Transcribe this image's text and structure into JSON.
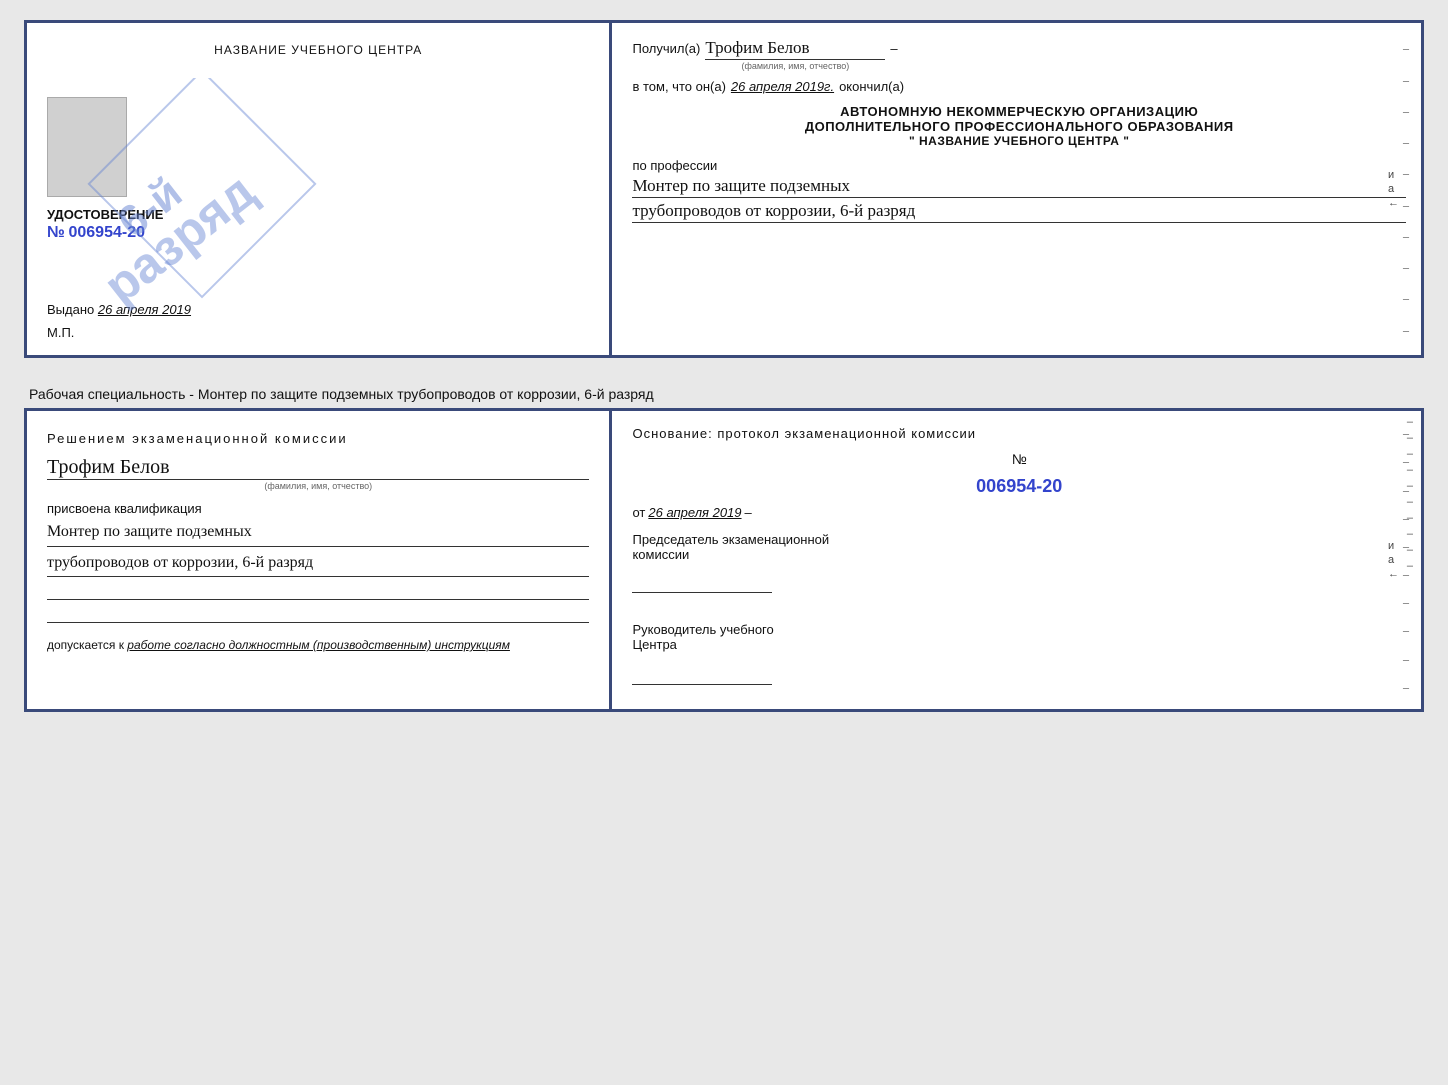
{
  "page": {
    "background": "#e8e8e8"
  },
  "top_cert": {
    "left": {
      "title": "НАЗВАНИЕ УЧЕБНОГО ЦЕНТРА",
      "stamp_lines": [
        "6-й",
        "разряд"
      ],
      "doc_type": "УДОСТОВЕРЕНИЕ",
      "doc_num_prefix": "№",
      "doc_num": "006954-20",
      "issued_prefix": "Выдано",
      "issued_date": "26 апреля 2019",
      "mp": "М.П."
    },
    "right": {
      "poluchil": "Получил(а)",
      "name": "Трофим Белов",
      "name_sub": "(фамилия, имя, отчество)",
      "vtom_prefix": "в том, что он(а)",
      "vtom_date": "26 апреля 2019г.",
      "vtom_suffix": "окончил(а)",
      "org_line1": "АВТОНОМНУЮ НЕКОММЕРЧЕСКУЮ ОРГАНИЗАЦИЮ",
      "org_line2": "ДОПОЛНИТЕЛЬНОГО ПРОФЕССИОНАЛЬНОГО ОБРАЗОВАНИЯ",
      "org_name": "\"  НАЗВАНИЕ УЧЕБНОГО ЦЕНТРА  \"",
      "po_professii": "по профессии",
      "profession1": "Монтер по защите подземных",
      "profession2": "трубопроводов от коррозии, 6-й разряд"
    }
  },
  "middle_text": "Рабочая специальность - Монтер по защите подземных трубопроводов от коррозии, 6-й разряд",
  "bottom_cert": {
    "left": {
      "resheniem": "Решением экзаменационной комиссии",
      "name": "Трофим Белов",
      "name_sub": "(фамилия, имя, отчество)",
      "prisvoena": "присвоена квалификация",
      "kvalf1": "Монтер по защите подземных",
      "kvalf2": "трубопроводов от коррозии, 6-й разряд",
      "dopusk": "допускается к",
      "dopusk_italic": "работе согласно должностным (производственным) инструкциям"
    },
    "right": {
      "osnovaniye": "Основание: протокол экзаменационной комиссии",
      "num_prefix": "№",
      "num": "006954-20",
      "ot_prefix": "от",
      "ot_date": "26 апреля 2019",
      "predsedatel_line1": "Председатель экзаменационной",
      "predsedatel_line2": "комиссии",
      "rukovoditel_line1": "Руководитель учебного",
      "rukovoditel_line2": "Центра"
    }
  }
}
